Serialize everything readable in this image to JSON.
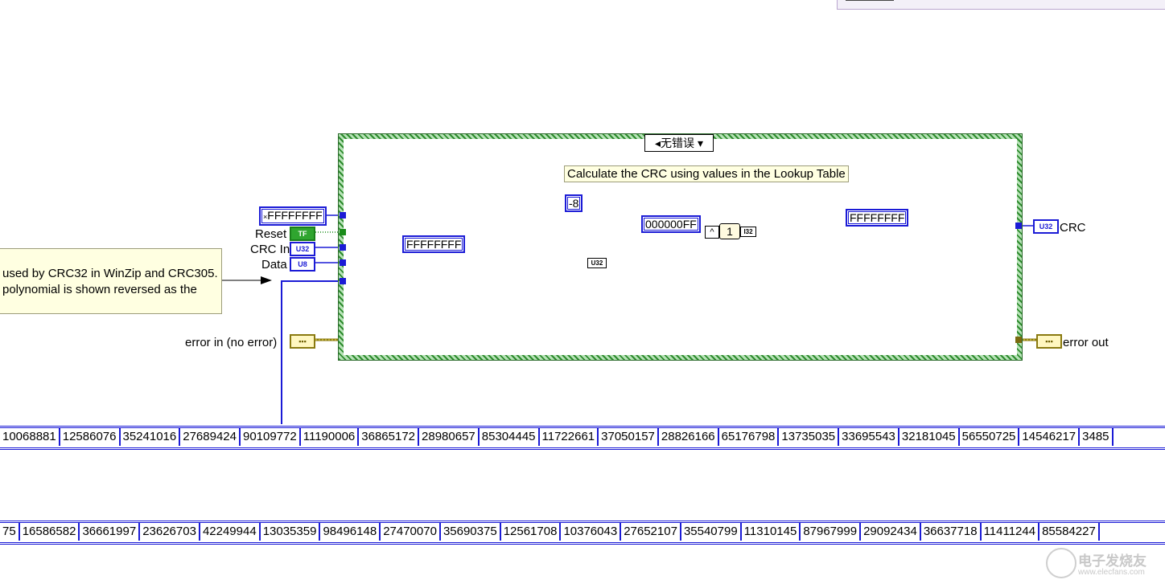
{
  "case_structure": {
    "selector_label": "无错误"
  },
  "comment": "Calculate the CRC using values in the Lookup Table",
  "side_note": {
    "line1": "used by CRC32 in WinZip and CRC305.",
    "line2": "polynomial is shown reversed as the"
  },
  "controls": {
    "init_const": "FFFFFFFF",
    "reset": "Reset",
    "crc_in": "CRC In",
    "data": "Data",
    "error_in": "error in (no error)",
    "tf_tag": "TF",
    "u32_tag": "U32",
    "u8_tag": "U8"
  },
  "indicators": {
    "crc": "CRC",
    "error_out": "error out",
    "u32_tag": "U32"
  },
  "constants": {
    "ffffffff_mid": "FFFFFFFF",
    "minus8": "-8",
    "mask": "000000FF",
    "one": "1",
    "ffffffff_right": "FFFFFFFF",
    "u32_conv": "U32",
    "i32": "I32",
    "and_op": "^"
  },
  "array_row1": [
    "10068881",
    "12586076",
    "35241016",
    "27689424",
    "90109772",
    "11190006",
    "36865172",
    "28980657",
    "85304445",
    "11722661",
    "37050157",
    "28826166",
    "65176798",
    "13735035",
    "33695543",
    "32181045",
    "56550725",
    "14546217",
    "3485"
  ],
  "array_row2": [
    "75",
    "16586582",
    "36661997",
    "23626703",
    "42249944",
    "13035359",
    "98496148",
    "27470070",
    "35690375",
    "12561708",
    "10376043",
    "27652107",
    "35540799",
    "11310145",
    "87967999",
    "29092434",
    "36637718",
    "11411244",
    "85584227"
  ],
  "watermark": {
    "brand": "电子发烧友",
    "url": "www.elecfans.com"
  }
}
